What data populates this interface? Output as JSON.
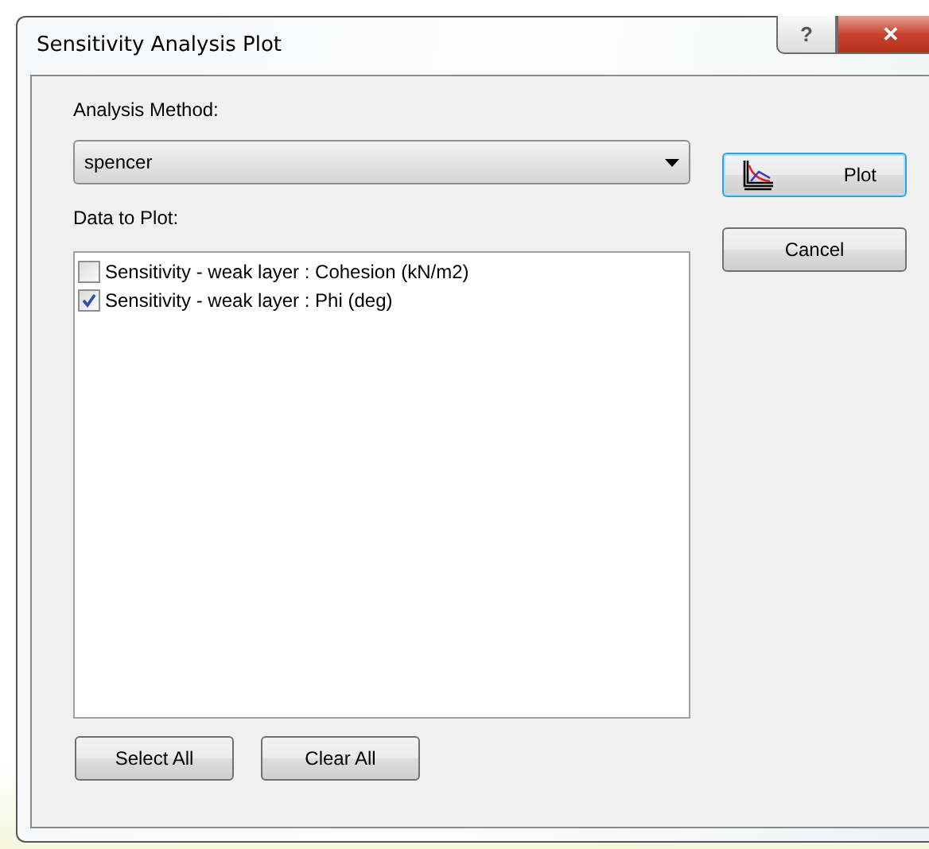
{
  "window": {
    "title": "Sensitivity Analysis Plot",
    "help_button": "?",
    "close_button": "✕"
  },
  "analysis_method": {
    "label": "Analysis Method:",
    "value": "spencer"
  },
  "data_to_plot": {
    "label": "Data to Plot:",
    "items": [
      {
        "label": "Sensitivity - weak layer : Cohesion (kN/m2)",
        "checked": false
      },
      {
        "label": "Sensitivity - weak layer : Phi (deg)",
        "checked": true
      }
    ]
  },
  "buttons": [
    {
      "kind": "plot",
      "label": "Plot",
      "default": true
    },
    {
      "kind": "cancel",
      "label": "Cancel",
      "default": false
    }
  ],
  "list_buttons": [
    "Select All",
    "Clear All"
  ]
}
